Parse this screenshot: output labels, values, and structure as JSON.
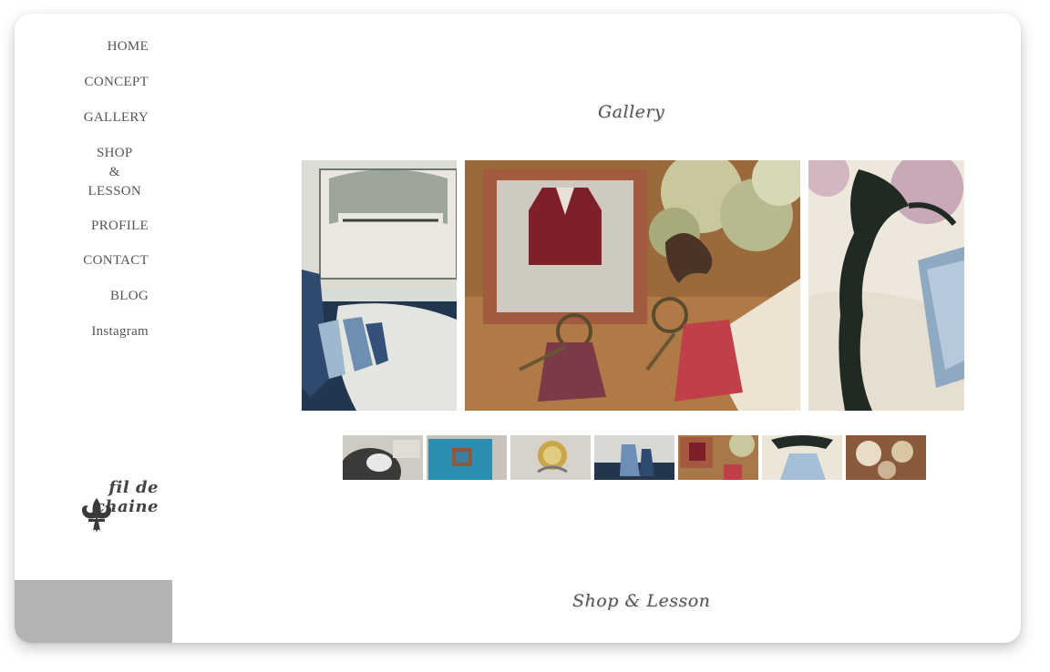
{
  "nav": {
    "items": [
      {
        "label": "HOME"
      },
      {
        "label": "CONCEPT"
      },
      {
        "label": "GALLERY"
      },
      {
        "label_lines": [
          "SHOP",
          "&",
          "LESSON"
        ]
      },
      {
        "label": "PROFILE"
      },
      {
        "label": "CONTACT"
      },
      {
        "label": "BLOG"
      },
      {
        "label": "Instagram"
      }
    ]
  },
  "logo": {
    "text": "fil de chaine"
  },
  "sections": {
    "gallery_title": "Gallery",
    "shop_title": "Shop & Lesson"
  },
  "slider": {
    "slides": [
      "slide-tassels-sheet-music",
      "slide-keyring-charms",
      "slide-tassel-stand"
    ],
    "active_index": 1
  },
  "thumbnails": {
    "items": [
      "thumb-silver-tray",
      "thumb-blue-box",
      "thumb-ring",
      "thumb-blue-tassels",
      "thumb-keyrings",
      "thumb-tassel-stand",
      "thumb-flowers"
    ]
  },
  "colors": {
    "nav_text": "#555555",
    "sidebar_block": "#b3b3b3",
    "background": "#ffffff"
  }
}
